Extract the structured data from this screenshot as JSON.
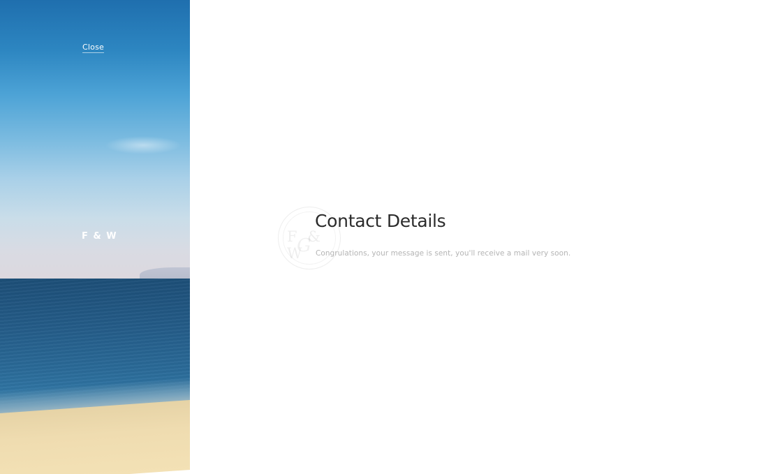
{
  "sidebar": {
    "close_label": "Close",
    "brand": "F & W"
  },
  "main": {
    "title": "Contact Details",
    "message": "Congrulations, your message is sent, you'll receive a mail very soon.",
    "stamp_brand": "F & W"
  },
  "colors": {
    "title": "#2b2b2b",
    "message": "#b4b4b4",
    "sky": "#2d86c1",
    "sea": "#245c88",
    "sand": "#efdcb0"
  }
}
